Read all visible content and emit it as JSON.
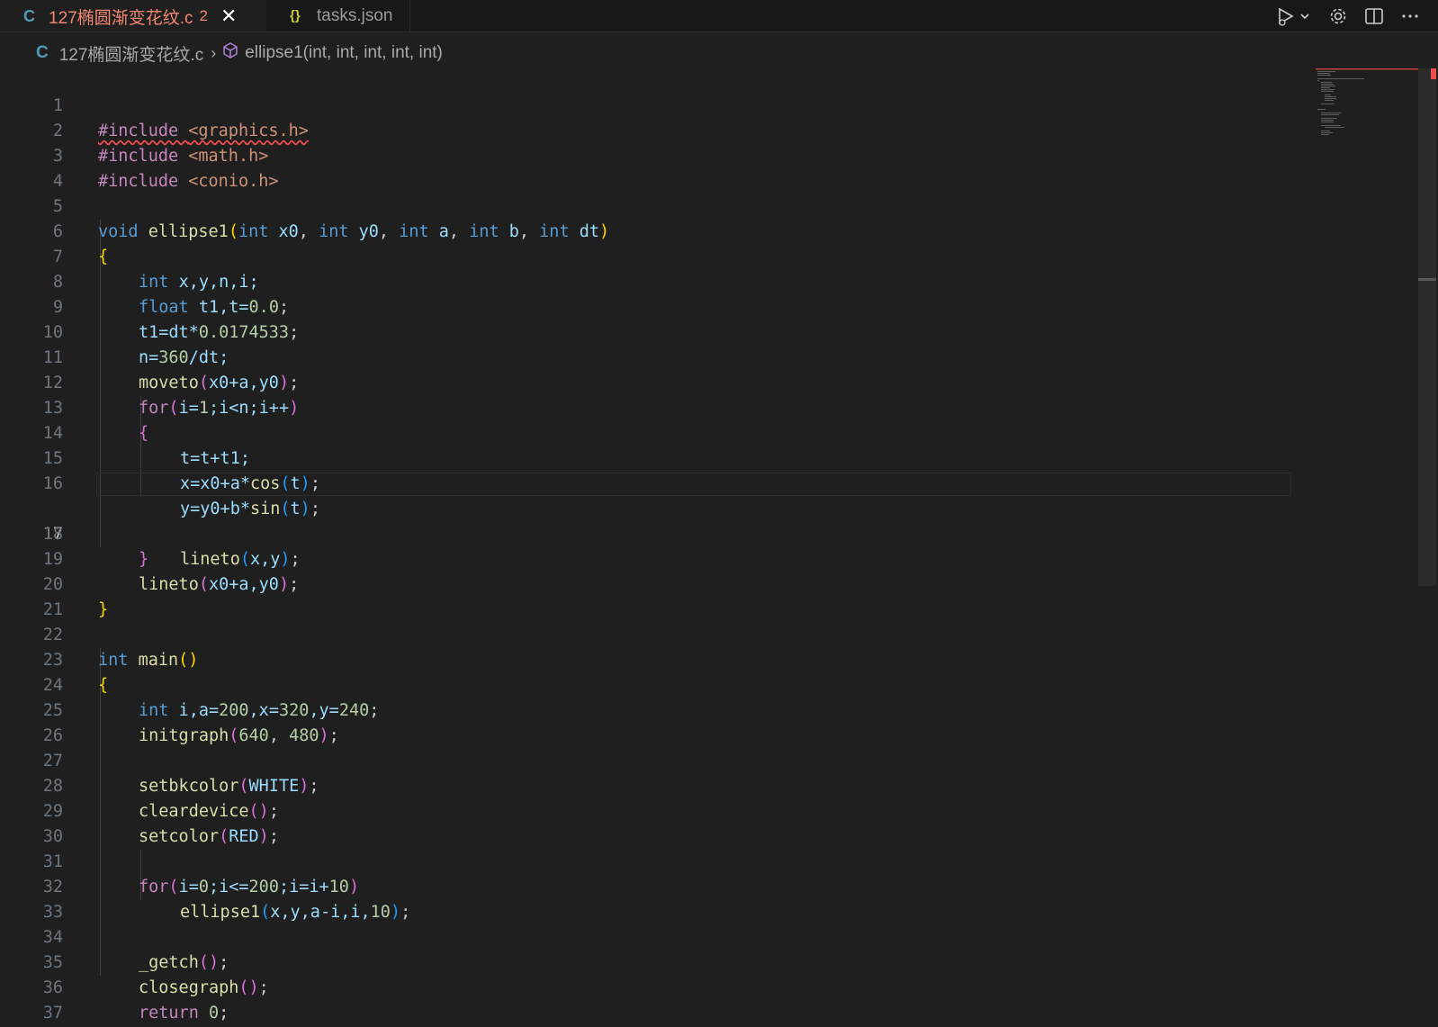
{
  "tabs": [
    {
      "icon": "C",
      "label": "127椭圆渐变花纹.c",
      "badge": "2",
      "active": true
    },
    {
      "icon": "{}",
      "label": "tasks.json",
      "active": false
    }
  ],
  "breadcrumb": {
    "icon": "C",
    "file": "127椭圆渐变花纹.c",
    "symbol": "ellipse1(int, int, int, int, int)"
  },
  "editor": {
    "current_line": 17,
    "lines": [
      {
        "n": "1"
      },
      {
        "n": "2"
      },
      {
        "n": "3"
      },
      {
        "n": "4"
      },
      {
        "n": "5"
      },
      {
        "n": "6"
      },
      {
        "n": "7"
      },
      {
        "n": "8"
      },
      {
        "n": "9"
      },
      {
        "n": "10"
      },
      {
        "n": "11"
      },
      {
        "n": "12"
      },
      {
        "n": "13"
      },
      {
        "n": "14"
      },
      {
        "n": "15"
      },
      {
        "n": "16"
      },
      {
        "n": "17"
      },
      {
        "n": "18"
      },
      {
        "n": "19"
      },
      {
        "n": "20"
      },
      {
        "n": "21"
      },
      {
        "n": "22"
      },
      {
        "n": "23"
      },
      {
        "n": "24"
      },
      {
        "n": "25"
      },
      {
        "n": "26"
      },
      {
        "n": "27"
      },
      {
        "n": "28"
      },
      {
        "n": "29"
      },
      {
        "n": "30"
      },
      {
        "n": "31"
      },
      {
        "n": "32"
      },
      {
        "n": "33"
      },
      {
        "n": "34"
      },
      {
        "n": "35"
      },
      {
        "n": "36"
      },
      {
        "n": "37"
      }
    ],
    "code": {
      "l1": {
        "a": "#include ",
        "b": "<graphics.h>"
      },
      "l2": {
        "a": "#include ",
        "b": "<math.h>"
      },
      "l3": {
        "a": "#include ",
        "b": "<conio.h>"
      },
      "l5": {
        "t1": "void",
        "fn": "ellipse1",
        "p1": "(",
        "k1": "int",
        "v1": "x0",
        ",1": ", ",
        "k2": "int",
        "v2": "y0",
        ",2": ", ",
        "k3": "int",
        "v3": "a",
        ",3": ", ",
        "k4": "int",
        "v4": "b",
        ",4": ", ",
        "k5": "int",
        "v5": "dt",
        "p2": ")"
      },
      "l6": "{",
      "l7": {
        "k": "int",
        "v": "x,y,n,i;"
      },
      "l8": {
        "k": "float",
        "v": "t1,t=",
        "n": "0.0",
        ";": ";"
      },
      "l9": {
        "v": "t1=dt*",
        "n": "0.0174533",
        ";": ";"
      },
      "l10": {
        "v": "n=",
        "n": "360",
        "r": "/dt;"
      },
      "l11": {
        "f": "moveto",
        "o": "(",
        "v": "x0+a,y0",
        "c": ")",
        ";": ";"
      },
      "l12": {
        "f": "for",
        "o": "(",
        "v": "i=",
        "n": "1",
        "r": ";i<n;i++",
        "c": ")"
      },
      "l13": "{",
      "l14": "t=t+t1;",
      "l15": {
        "v": "x=x0+a*",
        "f": "cos",
        "o": "(",
        "a": "t",
        "c": ")",
        ";": ";"
      },
      "l16": {
        "v": "y=y0+b*",
        "f": "sin",
        "o": "(",
        "a": "t",
        "c": ")",
        ";": ";"
      },
      "l17": {
        "f": "lineto",
        "o": "(",
        "v": "x,y",
        "c": ")",
        ";": ";"
      },
      "l18": "}",
      "l19": {
        "f": "lineto",
        "o": "(",
        "v": "x0+a,y0",
        "c": ")",
        ";": ";"
      },
      "l20": "}",
      "l22": {
        "k": "int",
        "f": "main",
        "p": "()"
      },
      "l23": "{",
      "l24": {
        "k": "int",
        "v1": "i,a=",
        "n1": "200",
        "v2": ",x=",
        "n2": "320",
        "v3": ",y=",
        "n3": "240",
        ";": ";"
      },
      "l25": {
        "f": "initgraph",
        "o": "(",
        "n1": "640",
        ",": ", ",
        "n2": "480",
        "c": ")",
        ";": ";"
      },
      "l27": {
        "f": "setbkcolor",
        "o": "(",
        "v": "WHITE",
        "c": ")",
        ";": ";"
      },
      "l28": {
        "f": "cleardevice",
        "p": "()",
        ";": ";"
      },
      "l29": {
        "f": "setcolor",
        "o": "(",
        "v": "RED",
        "c": ")",
        ";": ";"
      },
      "l31": {
        "f": "for",
        "o": "(",
        "v1": "i=",
        "n1": "0",
        "v2": ";i<=",
        "n2": "200",
        "v3": ";i=i+",
        "n3": "10",
        "c": ")"
      },
      "l32": {
        "f": "ellipse1",
        "o": "(",
        "v": "x,y,a-i,i,",
        "n": "10",
        "c": ")",
        ";": ";"
      },
      "l34": {
        "f": "_getch",
        "p": "()",
        ";": ";"
      },
      "l35": {
        "f": "closegraph",
        "p": "()",
        ";": ";"
      },
      "l36": {
        "k": "return",
        "n": "0",
        ";": ";"
      },
      "l37": "}"
    }
  }
}
